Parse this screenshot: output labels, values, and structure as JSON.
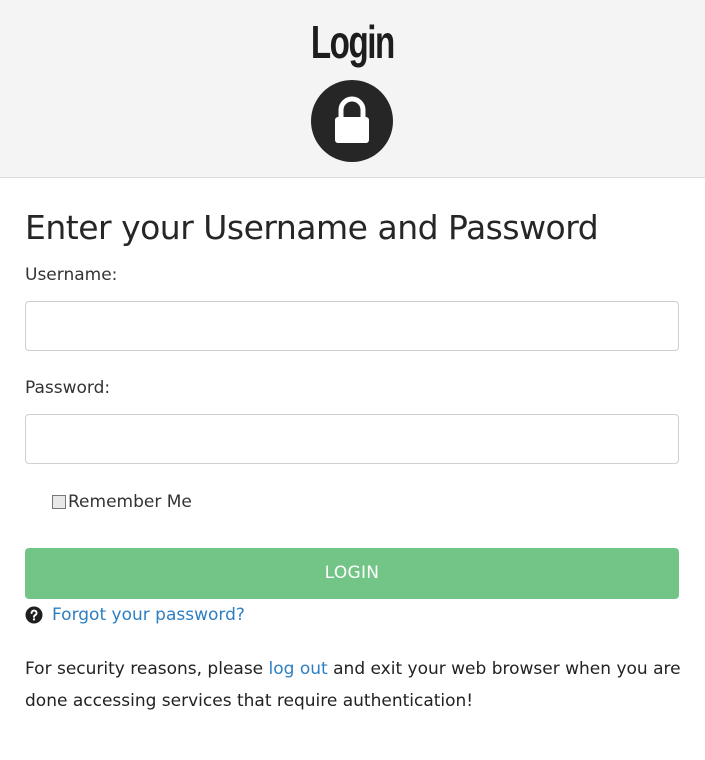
{
  "header": {
    "title": "Login",
    "icon": "lock-icon"
  },
  "form": {
    "heading": "Enter your Username and Password",
    "username_label": "Username:",
    "username_value": "",
    "password_label": "Password:",
    "password_value": "",
    "remember_label": "Remember Me",
    "remember_checked": false,
    "login_label": "LOGIN",
    "forgot_icon": "question-circle-icon",
    "forgot_label": "Forgot your password?"
  },
  "notice": {
    "before": "For security reasons, please ",
    "link": "log out",
    "after": " and exit your web browser when you are done accessing services that require authentication!"
  },
  "colors": {
    "header_bg": "#f4f4f4",
    "login_button": "#72c586",
    "link": "#2e7ec2",
    "lock_circle": "#262626"
  }
}
